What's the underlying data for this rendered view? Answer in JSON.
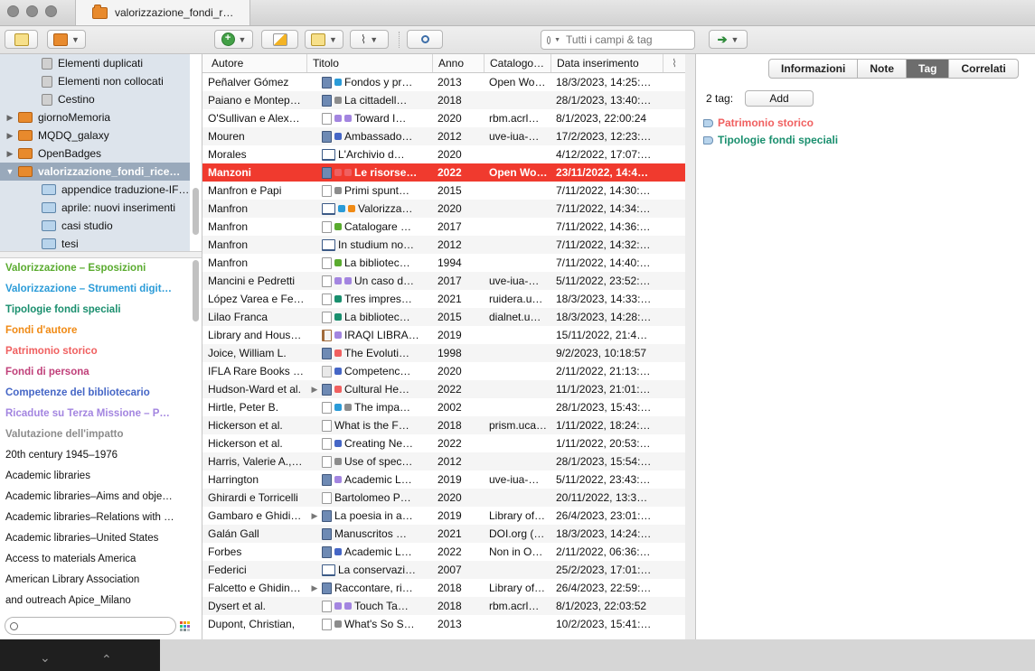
{
  "window": {
    "tab_title": "valorizzazione_fondi_r…"
  },
  "toolbar": {
    "search_placeholder": "Tutti i campi & tag"
  },
  "collections": [
    {
      "label": "Elementi duplicati",
      "indent": 1,
      "icon": "duplicate-icon",
      "expand": ""
    },
    {
      "label": "Elementi non collocati",
      "indent": 1,
      "icon": "unfiled-icon",
      "expand": ""
    },
    {
      "label": "Cestino",
      "indent": 1,
      "icon": "trash-icon",
      "expand": ""
    },
    {
      "label": "giornoMemoria",
      "indent": 0,
      "icon": "library-folder-icon",
      "expand": "▶"
    },
    {
      "label": "MQDQ_galaxy",
      "indent": 0,
      "icon": "library-folder-icon",
      "expand": "▶"
    },
    {
      "label": "OpenBadges",
      "indent": 0,
      "icon": "library-folder-icon",
      "expand": "▶"
    },
    {
      "label": "valorizzazione_fondi_rice…",
      "indent": 0,
      "icon": "library-folder-icon",
      "expand": "▼",
      "selected": true
    },
    {
      "label": "appendice traduzione-IF…",
      "indent": 1,
      "icon": "folder-icon",
      "expand": ""
    },
    {
      "label": "aprile: nuovi inserimenti",
      "indent": 1,
      "icon": "folder-icon",
      "expand": ""
    },
    {
      "label": "casi studio",
      "indent": 1,
      "icon": "folder-icon",
      "expand": ""
    },
    {
      "label": "tesi",
      "indent": 1,
      "icon": "folder-icon",
      "expand": ""
    }
  ],
  "tags": [
    {
      "label": "Valorizzazione – Esposizioni",
      "color": "#5aab2f",
      "bold": true
    },
    {
      "label": "Valorizzazione – Strumenti digit…",
      "color": "#2a9bd8",
      "bold": true
    },
    {
      "label": "Tipologie fondi speciali",
      "color": "#1a8f6e",
      "bold": true
    },
    {
      "label": "Fondi d'autore",
      "color": "#f08a14",
      "bold": true
    },
    {
      "label": "Patrimonio storico",
      "color": "#f06060",
      "bold": true
    },
    {
      "label": "Fondi di persona",
      "color": "#c0407a",
      "bold": true
    },
    {
      "label": "Competenze del bibliotecario",
      "color": "#4566c6",
      "bold": true
    },
    {
      "label": "Ricadute su Terza Missione – P…",
      "color": "#a385e0",
      "bold": true
    },
    {
      "label": "Valutazione dell'impatto",
      "color": "#8c8c8c",
      "bold": true
    },
    {
      "label": "20th century   1945–1976",
      "color": "#111111",
      "bold": false
    },
    {
      "label": "Academic libraries",
      "color": "#111111",
      "bold": false
    },
    {
      "label": "Academic libraries–Aims and obje…",
      "color": "#111111",
      "bold": false
    },
    {
      "label": "Academic libraries–Relations with …",
      "color": "#111111",
      "bold": false
    },
    {
      "label": "Academic libraries–United States",
      "color": "#111111",
      "bold": false
    },
    {
      "label": "Access to materials   America",
      "color": "#111111",
      "bold": false
    },
    {
      "label": "American Library Association",
      "color": "#111111",
      "bold": false
    },
    {
      "label": "and outreach   Apice_Milano",
      "color": "#111111",
      "bold": false
    }
  ],
  "table": {
    "columns": [
      "Autore",
      "Titolo",
      "Anno",
      "Catalogo…",
      "Data inserimento"
    ],
    "rows": [
      {
        "autore": "Peñalver Gómez",
        "titolo": "Fondos y pr…",
        "anno": "2013",
        "catalogo": "Open Wo…",
        "data": "18/3/2023, 14:25:…",
        "type": "book",
        "dots": [
          "#2a9bd8"
        ],
        "arrow": ""
      },
      {
        "autore": "Paiano e Montep…",
        "titolo": "La cittadell…",
        "anno": "2018",
        "catalogo": "",
        "data": "28/1/2023, 13:40:…",
        "type": "book",
        "dots": [
          "#8c8c8c"
        ],
        "arrow": ""
      },
      {
        "autore": "O'Sullivan e Alex…",
        "titolo": "Toward I…",
        "anno": "2020",
        "catalogo": "rbm.acrl…",
        "data": "8/1/2023, 22:00:24",
        "type": "doc",
        "dots": [
          "#a385e0",
          "#a385e0"
        ],
        "arrow": ""
      },
      {
        "autore": "Mouren",
        "titolo": "Ambassado…",
        "anno": "2012",
        "catalogo": "uve-iua-…",
        "data": "17/2/2023, 12:23:…",
        "type": "book",
        "dots": [
          "#4566c6"
        ],
        "arrow": ""
      },
      {
        "autore": "Morales",
        "titolo": "L'Archivio d…",
        "anno": "2020",
        "catalogo": "",
        "data": "4/12/2022, 17:07:…",
        "type": "open",
        "dots": [],
        "arrow": ""
      },
      {
        "autore": "Manzoni",
        "titolo": "Le risorse…",
        "anno": "2022",
        "catalogo": "Open Wo…",
        "data": "23/11/2022, 14:4…",
        "type": "book",
        "dots": [
          "#f06060",
          "#f06060"
        ],
        "arrow": "",
        "selected": true
      },
      {
        "autore": "Manfron e Papi",
        "titolo": "Primi spunt…",
        "anno": "2015",
        "catalogo": "",
        "data": "7/11/2022, 14:30:…",
        "type": "doc",
        "dots": [
          "#8c8c8c"
        ],
        "arrow": ""
      },
      {
        "autore": "Manfron",
        "titolo": "Valorizza…",
        "anno": "2020",
        "catalogo": "",
        "data": "7/11/2022, 14:34:…",
        "type": "open",
        "dots": [
          "#2a9bd8",
          "#f08a14"
        ],
        "arrow": ""
      },
      {
        "autore": "Manfron",
        "titolo": "Catalogare …",
        "anno": "2017",
        "catalogo": "",
        "data": "7/11/2022, 14:36:…",
        "type": "doc",
        "dots": [
          "#5aab2f"
        ],
        "arrow": ""
      },
      {
        "autore": "Manfron",
        "titolo": "In studium no…",
        "anno": "2012",
        "catalogo": "",
        "data": "7/11/2022, 14:32:…",
        "type": "open",
        "dots": [],
        "arrow": ""
      },
      {
        "autore": "Manfron",
        "titolo": "La bibliotec…",
        "anno": "1994",
        "catalogo": "",
        "data": "7/11/2022, 14:40:…",
        "type": "doc",
        "dots": [
          "#5aab2f"
        ],
        "arrow": ""
      },
      {
        "autore": "Mancini e Pedretti",
        "titolo": "Un caso d…",
        "anno": "2017",
        "catalogo": "uve-iua-…",
        "data": "5/11/2022, 23:52:…",
        "type": "doc",
        "dots": [
          "#a385e0",
          "#a385e0"
        ],
        "arrow": ""
      },
      {
        "autore": "López Varea e Fe…",
        "titolo": "Tres impres…",
        "anno": "2021",
        "catalogo": "ruidera.u…",
        "data": "18/3/2023, 14:33:…",
        "type": "doc",
        "dots": [
          "#1a8f6e"
        ],
        "arrow": ""
      },
      {
        "autore": "Lilao Franca",
        "titolo": "La bibliotec…",
        "anno": "2015",
        "catalogo": "dialnet.u…",
        "data": "18/3/2023, 14:28:…",
        "type": "doc",
        "dots": [
          "#1a8f6e"
        ],
        "arrow": ""
      },
      {
        "autore": "Library and Hous…",
        "titolo": "IRAQI LIBRA…",
        "anno": "2019",
        "catalogo": "",
        "data": "15/11/2022, 21:4…",
        "type": "rep",
        "dots": [
          "#a385e0"
        ],
        "arrow": ""
      },
      {
        "autore": "Joice, William L.",
        "titolo": "The Evoluti…",
        "anno": "1998",
        "catalogo": "",
        "data": "9/2/2023, 10:18:57",
        "type": "book",
        "dots": [
          "#f06060"
        ],
        "arrow": ""
      },
      {
        "autore": "IFLA Rare Books …",
        "titolo": "Competenc…",
        "anno": "2020",
        "catalogo": "",
        "data": "2/11/2022, 21:13:…",
        "type": "sq",
        "dots": [
          "#4566c6"
        ],
        "arrow": ""
      },
      {
        "autore": "Hudson-Ward et al.",
        "titolo": "Cultural He…",
        "anno": "2022",
        "catalogo": "",
        "data": "11/1/2023, 21:01:…",
        "type": "book",
        "dots": [
          "#f06060"
        ],
        "arrow": "▶"
      },
      {
        "autore": "Hirtle, Peter B.",
        "titolo": "The impa…",
        "anno": "2002",
        "catalogo": "",
        "data": "28/1/2023, 15:43:…",
        "type": "doc",
        "dots": [
          "#2a9bd8",
          "#8c8c8c"
        ],
        "arrow": ""
      },
      {
        "autore": "Hickerson et al.",
        "titolo": "What is the F…",
        "anno": "2018",
        "catalogo": "prism.uca…",
        "data": "1/11/2022, 18:24:…",
        "type": "doc",
        "dots": [],
        "arrow": ""
      },
      {
        "autore": "Hickerson et al.",
        "titolo": "Creating Ne…",
        "anno": "2022",
        "catalogo": "",
        "data": "1/11/2022, 20:53:…",
        "type": "doc",
        "dots": [
          "#4566c6"
        ],
        "arrow": ""
      },
      {
        "autore": "Harris, Valerie A.,…",
        "titolo": "Use of spec…",
        "anno": "2012",
        "catalogo": "",
        "data": "28/1/2023, 15:54:…",
        "type": "doc",
        "dots": [
          "#8c8c8c"
        ],
        "arrow": ""
      },
      {
        "autore": "Harrington",
        "titolo": "Academic L…",
        "anno": "2019",
        "catalogo": "uve-iua-…",
        "data": "5/11/2022, 23:43:…",
        "type": "book",
        "dots": [
          "#a385e0"
        ],
        "arrow": ""
      },
      {
        "autore": "Ghirardi e Torricelli",
        "titolo": "Bartolomeo P…",
        "anno": "2020",
        "catalogo": "",
        "data": "20/11/2022, 13:3…",
        "type": "doc",
        "dots": [],
        "arrow": ""
      },
      {
        "autore": "Gambaro e Ghidi…",
        "titolo": "La poesia in a…",
        "anno": "2019",
        "catalogo": "Library of…",
        "data": "26/4/2023, 23:01:…",
        "type": "book",
        "dots": [],
        "arrow": "▶"
      },
      {
        "autore": "Galán Gall",
        "titolo": "Manuscritos …",
        "anno": "2021",
        "catalogo": "DOI.org (…",
        "data": "18/3/2023, 14:24:…",
        "type": "book",
        "dots": [],
        "arrow": ""
      },
      {
        "autore": "Forbes",
        "titolo": "Academic L…",
        "anno": "2022",
        "catalogo": "Non in O…",
        "data": "2/11/2022, 06:36:…",
        "type": "book",
        "dots": [
          "#4566c6"
        ],
        "arrow": ""
      },
      {
        "autore": "Federici",
        "titolo": "La conservazi…",
        "anno": "2007",
        "catalogo": "",
        "data": "25/2/2023, 17:01:…",
        "type": "open",
        "dots": [],
        "arrow": ""
      },
      {
        "autore": "Falcetto e Ghidin…",
        "titolo": "Raccontare, ri…",
        "anno": "2018",
        "catalogo": "Library of…",
        "data": "26/4/2023, 22:59:…",
        "type": "book",
        "dots": [],
        "arrow": "▶"
      },
      {
        "autore": "Dysert et al.",
        "titolo": "Touch Ta…",
        "anno": "2018",
        "catalogo": "rbm.acrl…",
        "data": "8/1/2023, 22:03:52",
        "type": "doc",
        "dots": [
          "#a385e0",
          "#a385e0"
        ],
        "arrow": ""
      },
      {
        "autore": "Dupont, Christian,",
        "titolo": "What's So S…",
        "anno": "2013",
        "catalogo": "",
        "data": "10/2/2023, 15:41:…",
        "type": "doc",
        "dots": [
          "#8c8c8c"
        ],
        "arrow": ""
      }
    ]
  },
  "right": {
    "tabs": [
      {
        "label": "Informazioni",
        "active": false
      },
      {
        "label": "Note",
        "active": false
      },
      {
        "label": "Tag",
        "active": true
      },
      {
        "label": "Correlati",
        "active": false
      }
    ],
    "tag_count": "2 tag:",
    "add_label": "Add",
    "item_tags": [
      {
        "label": "Patrimonio storico",
        "color": "#f06060"
      },
      {
        "label": "Tipologie fondi speciali",
        "color": "#1a8f6e"
      }
    ]
  }
}
